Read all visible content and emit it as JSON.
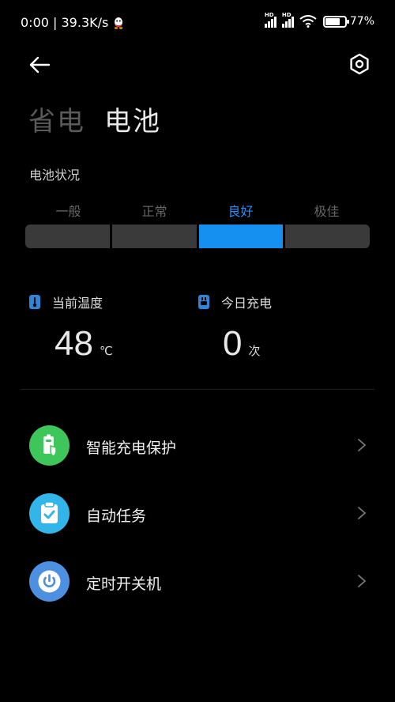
{
  "status_bar": {
    "time_speed": "0:00 | 39.3K/s",
    "battery_percent": "77%",
    "battery_level": 0.77,
    "signal_labels": [
      "HD",
      "HD"
    ]
  },
  "header": {
    "tabs": [
      {
        "label": "省电",
        "active": false
      },
      {
        "label": "电池",
        "active": true
      }
    ]
  },
  "battery_status": {
    "label": "电池状况",
    "levels": [
      "一般",
      "正常",
      "良好",
      "极佳"
    ],
    "active_index": 2,
    "active_color": "#1590f0"
  },
  "stats": {
    "temperature": {
      "label": "当前温度",
      "value": "48",
      "unit": "℃"
    },
    "charges_today": {
      "label": "今日充电",
      "value": "0",
      "unit": "次"
    }
  },
  "menu": [
    {
      "label": "智能充电保护",
      "icon": "battery-shield-icon",
      "color": "#3ec65a"
    },
    {
      "label": "自动任务",
      "icon": "clipboard-check-icon",
      "color": "#32b6ea"
    },
    {
      "label": "定时开关机",
      "icon": "power-icon",
      "color": "#4d8fe0"
    }
  ]
}
